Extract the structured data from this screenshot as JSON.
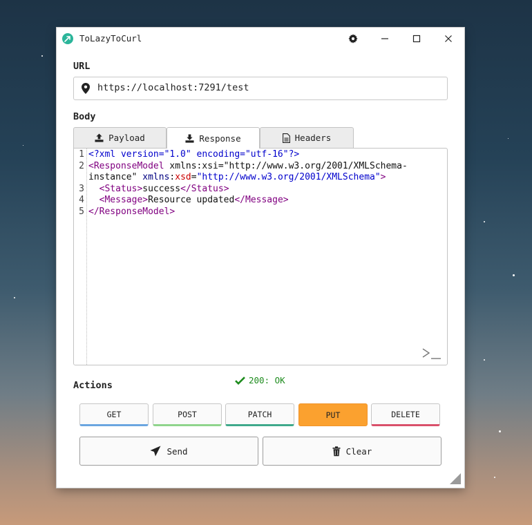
{
  "window": {
    "title": "ToLazyToCurl"
  },
  "url": {
    "label": "URL",
    "value": "https://localhost:7291/test"
  },
  "body": {
    "label": "Body",
    "tabs": [
      {
        "label": "Payload",
        "icon": "upload-icon"
      },
      {
        "label": "Response",
        "icon": "download-icon",
        "active": true
      },
      {
        "label": "Headers",
        "icon": "document-icon"
      }
    ]
  },
  "editor": {
    "line_numbers": [
      "1",
      "2",
      "3",
      "4",
      "5"
    ],
    "lines": [
      "<?xml version=\"1.0\" encoding=\"utf-16\"?>",
      "<ResponseModel xmlns:xsi=\"http://www.w3.org/2001/XMLSchema-instance\" xmlns:xsd=\"http://www.w3.org/2001/XMLSchema\">",
      "  <Status>success</Status>",
      "  <Message>Resource updated</Message>",
      "</ResponseModel>"
    ]
  },
  "actions": {
    "label": "Actions",
    "status": "200: OK",
    "methods": [
      {
        "label": "GET",
        "color": "#6aa5e0"
      },
      {
        "label": "POST",
        "color": "#8fd48c"
      },
      {
        "label": "PATCH",
        "color": "#3fa98b"
      },
      {
        "label": "PUT",
        "color": "#fba12f",
        "active": true
      },
      {
        "label": "DELETE",
        "color": "#d9506a"
      }
    ],
    "send_label": "Send",
    "clear_label": "Clear"
  },
  "colors": {
    "accent": "#fba12f",
    "status_ok": "#1e8c1e",
    "app_icon": "#2bb59a"
  }
}
